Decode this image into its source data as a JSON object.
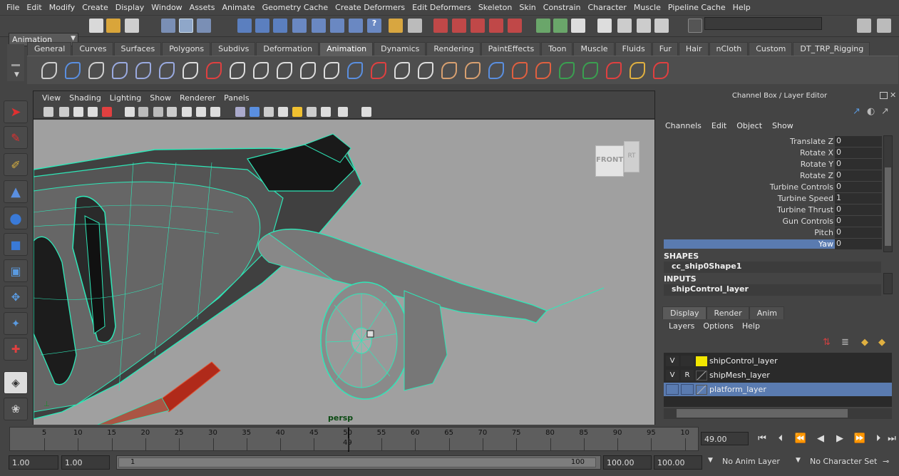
{
  "menubar": [
    "File",
    "Edit",
    "Modify",
    "Create",
    "Display",
    "Window",
    "Assets",
    "Animate",
    "Geometry Cache",
    "Create Deformers",
    "Edit Deformers",
    "Skeleton",
    "Skin",
    "Constrain",
    "Character",
    "Muscle",
    "Pipeline Cache",
    "Help"
  ],
  "status": {
    "mode": "Animation"
  },
  "shelf_tabs": [
    "General",
    "Curves",
    "Surfaces",
    "Polygons",
    "Subdivs",
    "Deformation",
    "Animation",
    "Dynamics",
    "Rendering",
    "PaintEffects",
    "Toon",
    "Muscle",
    "Fluids",
    "Fur",
    "Hair",
    "nCloth",
    "Custom",
    "DT_TRP_Rigging"
  ],
  "shelf_active": "Animation",
  "viewport": {
    "menu": [
      "View",
      "Shading",
      "Lighting",
      "Show",
      "Renderer",
      "Panels"
    ],
    "camera": "persp",
    "viewcube_front": "FRONT",
    "viewcube_side": "RT"
  },
  "channel_box": {
    "title": "Channel Box / Layer Editor",
    "menu": [
      "Channels",
      "Edit",
      "Object",
      "Show"
    ],
    "attributes": [
      {
        "name": "Translate Z",
        "value": "0"
      },
      {
        "name": "Rotate X",
        "value": "0"
      },
      {
        "name": "Rotate Y",
        "value": "0"
      },
      {
        "name": "Rotate Z",
        "value": "0"
      },
      {
        "name": "Turbine Controls",
        "value": "0"
      },
      {
        "name": "Turbine Speed",
        "value": "1"
      },
      {
        "name": "Turbine Thrust",
        "value": "0"
      },
      {
        "name": "Gun Controls",
        "value": "0"
      },
      {
        "name": "Pitch",
        "value": "0"
      },
      {
        "name": "Yaw",
        "value": "0"
      }
    ],
    "shapes_header": "SHAPES",
    "shape_node": "cc_ship0Shape1",
    "inputs_header": "INPUTS",
    "input_node": "shipControl_layer"
  },
  "layer_editor": {
    "tabs": [
      "Display",
      "Render",
      "Anim"
    ],
    "menu": [
      "Layers",
      "Options",
      "Help"
    ],
    "layers": [
      {
        "v": "V",
        "r": "",
        "name": "shipControl_layer",
        "color": "#f2e600"
      },
      {
        "v": "V",
        "r": "R",
        "name": "shipMesh_layer",
        "color": ""
      },
      {
        "v": "",
        "r": "",
        "name": "platform_layer",
        "color": ""
      }
    ]
  },
  "timeline": {
    "ticks": [
      "5",
      "10",
      "15",
      "20",
      "25",
      "30",
      "35",
      "40",
      "45",
      "50",
      "55",
      "60",
      "65",
      "70",
      "75",
      "80",
      "85",
      "90",
      "95",
      "10"
    ],
    "current_label": "49",
    "current_frame": "49.00"
  },
  "range": {
    "start": "1.00",
    "anim_start": "1.00",
    "slider_start": "1",
    "slider_end": "100",
    "anim_end": "100.00",
    "end": "100.00",
    "anim_layer": "No Anim Layer",
    "character_set": "No Character Set"
  }
}
